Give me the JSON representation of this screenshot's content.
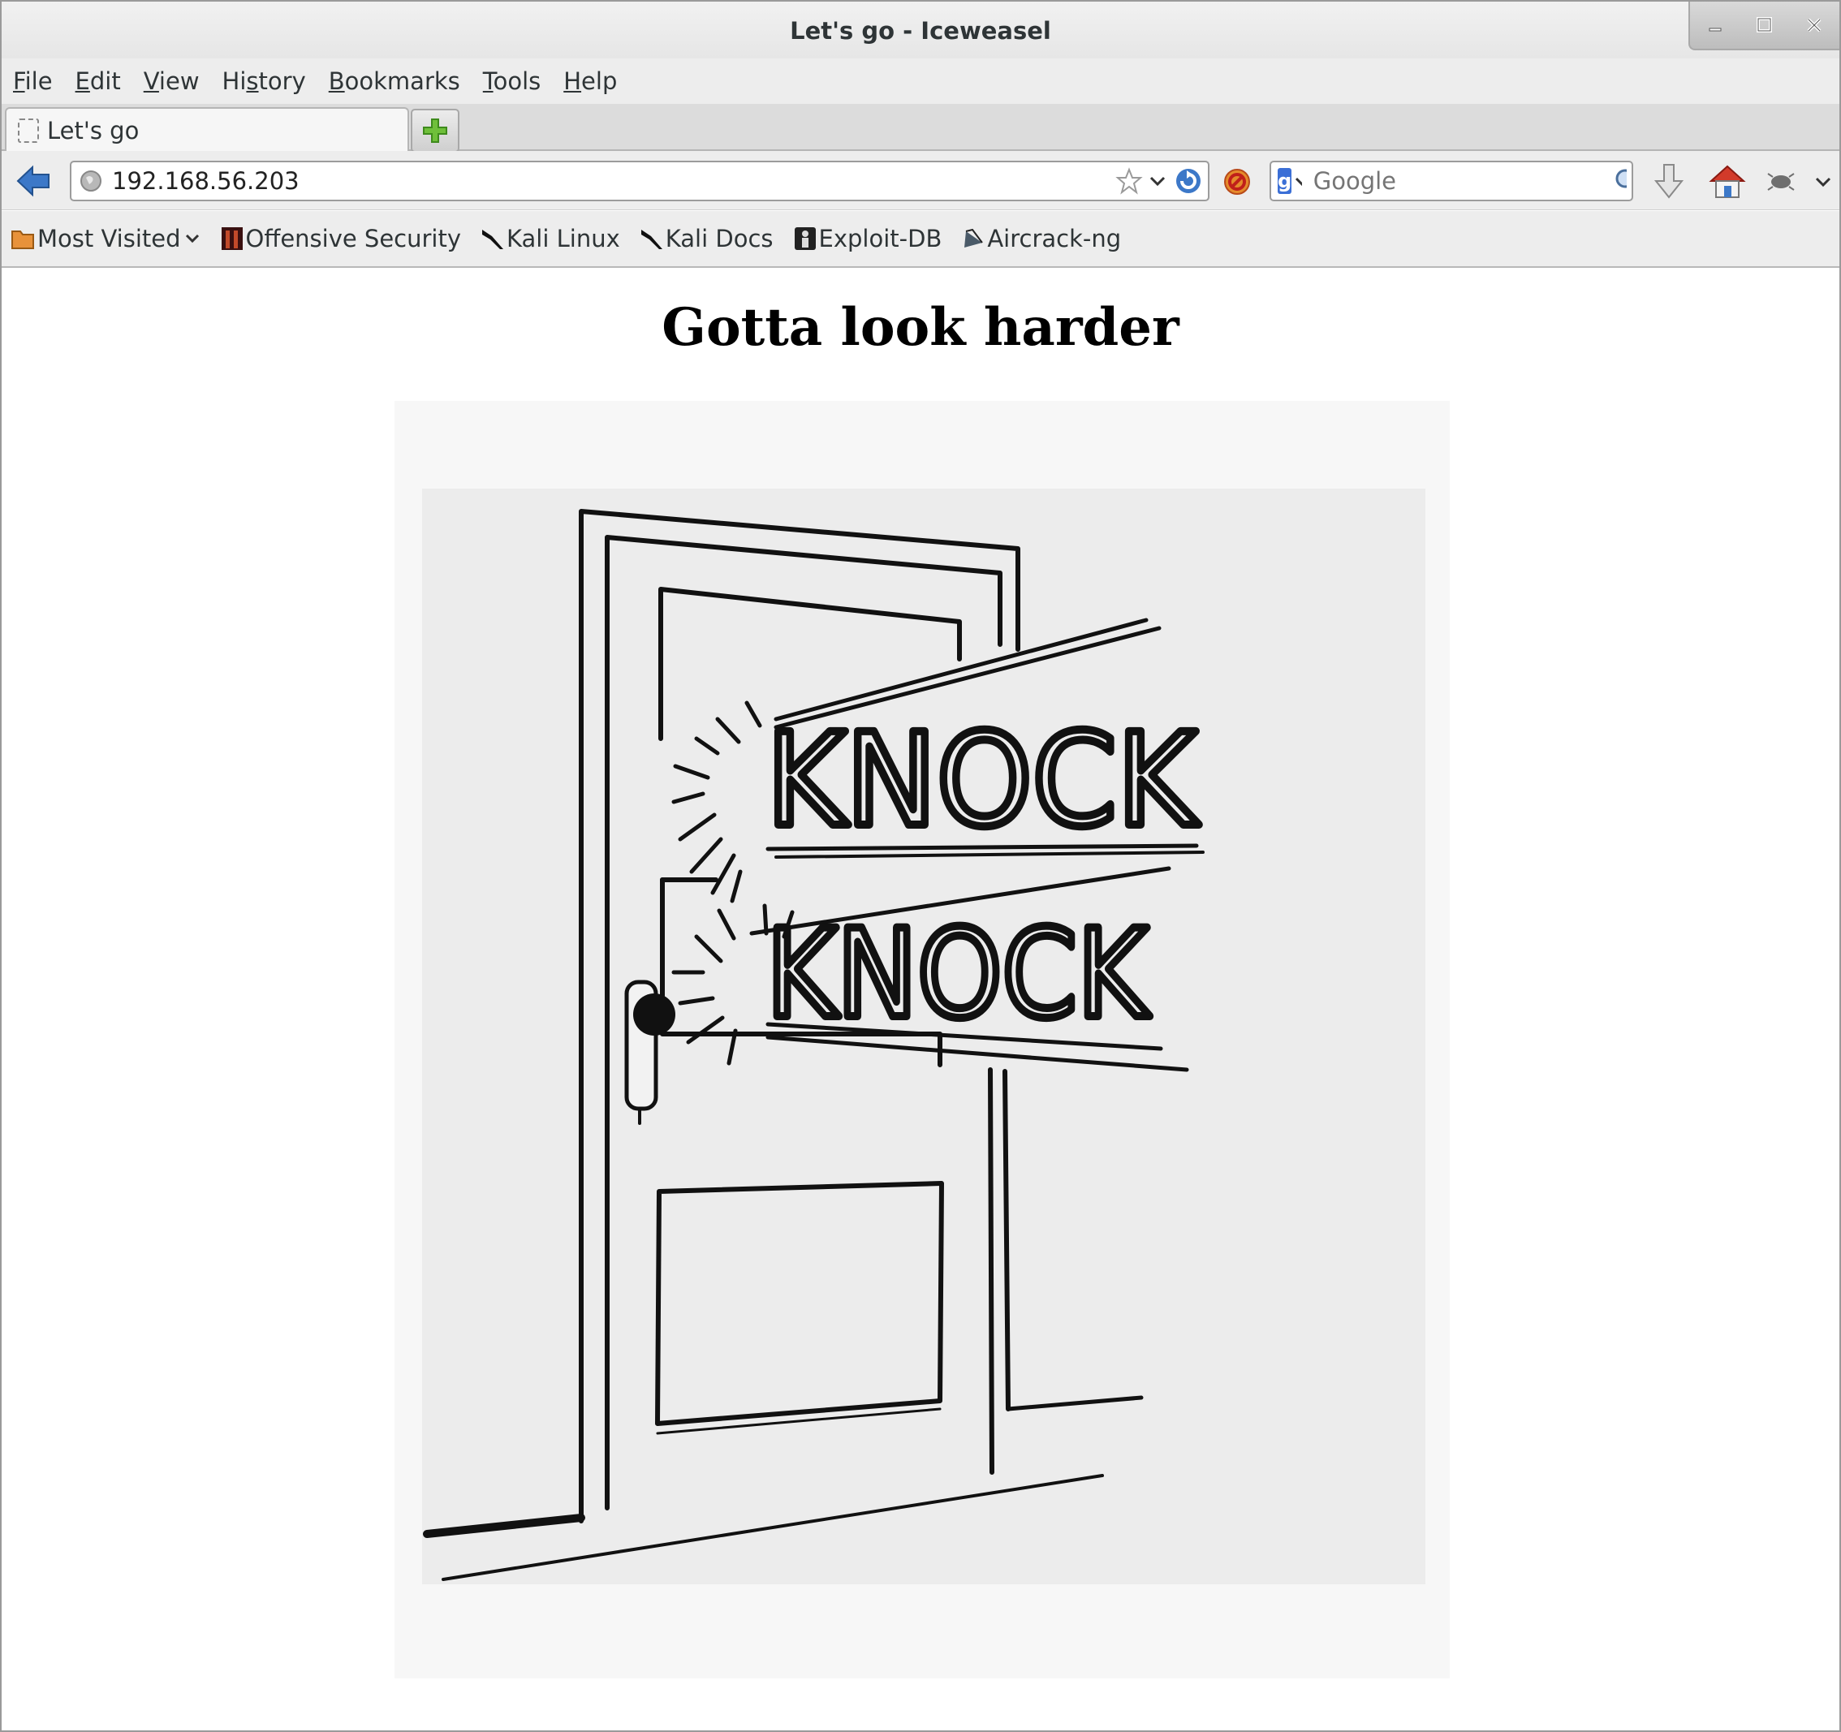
{
  "window": {
    "title": "Let's go - Iceweasel"
  },
  "menubar": {
    "items": [
      {
        "label": "File",
        "accel": "F",
        "rest": "ile"
      },
      {
        "label": "Edit",
        "accel": "E",
        "rest": "dit"
      },
      {
        "label": "View",
        "accel": "V",
        "rest": "iew"
      },
      {
        "label": "History",
        "pre": "Hi",
        "accel": "s",
        "rest": "tory"
      },
      {
        "label": "Bookmarks",
        "accel": "B",
        "rest": "ookmarks"
      },
      {
        "label": "Tools",
        "accel": "T",
        "rest": "ools"
      },
      {
        "label": "Help",
        "accel": "H",
        "rest": "elp"
      }
    ]
  },
  "tabs": [
    {
      "label": "Let's go",
      "active": true
    }
  ],
  "navbar": {
    "url": "192.168.56.203",
    "search_placeholder": "Google"
  },
  "bookmarks": [
    {
      "label": "Most Visited",
      "icon": "folder-icon",
      "dropdown": true
    },
    {
      "label": "Offensive Security",
      "icon": "offsec-icon"
    },
    {
      "label": "Kali Linux",
      "icon": "kali-dragon-icon"
    },
    {
      "label": "Kali Docs",
      "icon": "kali-dragon-icon"
    },
    {
      "label": "Exploit-DB",
      "icon": "exploit-db-icon"
    },
    {
      "label": "Aircrack-ng",
      "icon": "aircrack-icon"
    }
  ],
  "page": {
    "heading": "Gotta look harder",
    "image": {
      "words": [
        "KNOCK",
        "KNOCK"
      ]
    }
  },
  "colors": {
    "chrome_bg": "#ededed",
    "accent_blue": "#3b6fd6"
  }
}
